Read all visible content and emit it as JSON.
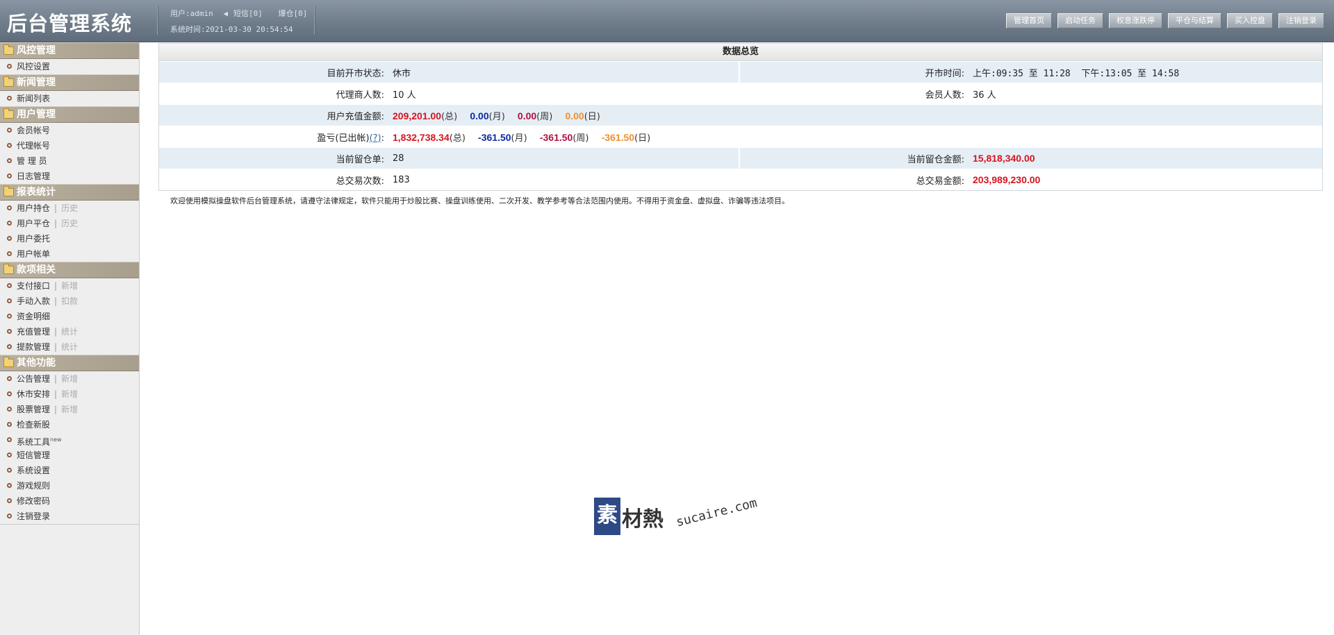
{
  "header": {
    "title": "后台管理系统",
    "user": "用户:admin",
    "sms": "短信[0]",
    "liquidation": "爆仓[0]",
    "system_time": "系统时间:2021-03-30 20:54:54",
    "buttons": [
      "管理首页",
      "启动任务",
      "权息涨跌停",
      "平仓与结算",
      "买入控盘",
      "注销登录"
    ]
  },
  "sidebar": [
    {
      "title": "风控管理",
      "items": [
        {
          "label": "风控设置"
        }
      ]
    },
    {
      "title": "新闻管理",
      "items": [
        {
          "label": "新闻列表"
        }
      ]
    },
    {
      "title": "用户管理",
      "items": [
        {
          "label": "会员帐号"
        },
        {
          "label": "代理帐号"
        },
        {
          "label": "管 理 员"
        },
        {
          "label": "日志管理"
        }
      ]
    },
    {
      "title": "报表统计",
      "items": [
        {
          "label": "用户持仓",
          "alt": "历史"
        },
        {
          "label": "用户平仓",
          "alt": "历史"
        },
        {
          "label": "用户委托"
        },
        {
          "label": "用户帐单"
        }
      ]
    },
    {
      "title": "款项相关",
      "items": [
        {
          "label": "支付接口",
          "alt": "新增"
        },
        {
          "label": "手动入款",
          "alt": "扣款"
        },
        {
          "label": "资金明细"
        },
        {
          "label": "充值管理",
          "alt": "统计"
        },
        {
          "label": "提款管理",
          "alt": "统计"
        }
      ]
    },
    {
      "title": "其他功能",
      "items": [
        {
          "label": "公告管理",
          "alt": "新增"
        },
        {
          "label": "休市安排",
          "alt": "新增"
        },
        {
          "label": "股票管理",
          "alt": "新增"
        },
        {
          "label": "检查新股"
        },
        {
          "label": "系统工具",
          "sup": "new"
        },
        {
          "label": "短信管理"
        },
        {
          "label": "系统设置"
        },
        {
          "label": "游戏规则"
        },
        {
          "label": "修改密码"
        },
        {
          "label": "注销登录"
        }
      ]
    }
  ],
  "overview": {
    "title": "数据总览",
    "market_status_label": "目前开市状态:",
    "market_status": "休市",
    "open_time_label": "开市时间:",
    "open_time": "上午:09:35 至 11:28  下午:13:05 至 14:58",
    "agents_label": "代理商人数:",
    "agents": "10 人",
    "members_label": "会员人数:",
    "members": "36 人",
    "recharge_label": "用户充值金额:",
    "recharge_total": "209,201.00",
    "recharge_month": "0.00",
    "recharge_week": "0.00",
    "recharge_day": "0.00",
    "pnl_label": "盈亏(已出帐)",
    "pnl_help": "(?)",
    "pnl_colon": ":",
    "pnl_total": "1,832,738.34",
    "pnl_month": "-361.50",
    "pnl_week": "-361.50",
    "pnl_day": "-361.50",
    "unit_total": "(总)",
    "unit_month": "(月)",
    "unit_week": "(周)",
    "unit_day": "(日)",
    "open_orders_label": "当前留仓单:",
    "open_orders": "28",
    "open_amount_label": "当前留仓金额:",
    "open_amount": "15,818,340.00",
    "trade_count_label": "总交易次数:",
    "trade_count": "183",
    "trade_amount_label": "总交易金额:",
    "trade_amount": "203,989,230.00"
  },
  "notice": "欢迎使用模拟操盘软件后台管理系统，请遵守法律规定，软件只能用于炒股比赛、操盘训练使用、二次开发、教学参考等合法范围内使用。不得用于资金盘、虚拟盘、诈骗等违法项目。",
  "watermark": {
    "char": "素",
    "cn": "材熱",
    "en": "sucaire.com"
  },
  "colors": {
    "header": "#6f7c8a",
    "sidebar_cat": "#b1a897",
    "row_alt": "#e6eef5",
    "red": "#d8131d",
    "blue": "#0b2aa8",
    "orange": "#f0902a"
  }
}
